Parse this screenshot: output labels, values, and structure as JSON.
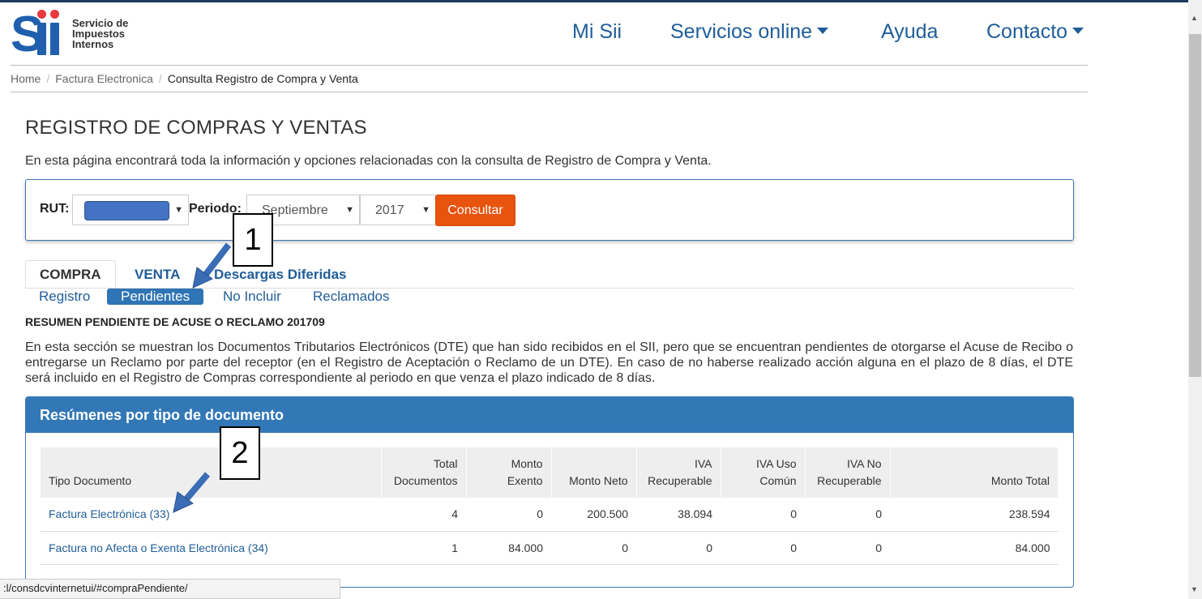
{
  "header": {
    "logo_lines": [
      "Servicio de",
      "Impuestos",
      "Internos"
    ],
    "nav": [
      {
        "label": "Mi Sii",
        "dropdown": false
      },
      {
        "label": "Servicios online",
        "dropdown": true
      },
      {
        "label": "Ayuda",
        "dropdown": false
      },
      {
        "label": "Contacto",
        "dropdown": true
      }
    ]
  },
  "breadcrumb": {
    "items": [
      "Home",
      "Factura Electronica"
    ],
    "current": "Consulta Registro de Compra y Venta"
  },
  "page": {
    "title": "REGISTRO DE COMPRAS Y VENTAS",
    "intro": "En esta página encontrará toda la información y opciones relacionadas con la consulta de Registro de Compra y Venta."
  },
  "filters": {
    "rut_label": "RUT:",
    "periodo_label": "Periodo:",
    "month": "Septiembre",
    "year": "2017",
    "submit_label": "Consultar"
  },
  "tabs": {
    "items": [
      "COMPRA",
      "VENTA",
      "Descargas Diferidas"
    ],
    "active": "COMPRA"
  },
  "subtabs": {
    "items": [
      "Registro",
      "Pendientes",
      "No Incluir",
      "Reclamados"
    ],
    "active": "Pendientes"
  },
  "section": {
    "heading": "RESUMEN PENDIENTE DE ACUSE O RECLAMO 201709",
    "description": "En esta sección se muestran los Documentos Tributarios Electrónicos (DTE) que han sido recibidos en el SII, pero que se encuentran pendientes de otorgarse el Acuse de Recibo o entregarse un Reclamo por parte del receptor (en el Registro de Aceptación o Reclamo de un DTE). En caso de no haberse realizado acción alguna en el plazo de 8 días, el DTE será incluido en el Registro de Compras correspondiente al periodo en que venza el plazo indicado de 8 días."
  },
  "summary_panel": {
    "title": "Resúmenes por tipo de documento",
    "columns": [
      [
        "Tipo Documento"
      ],
      [
        "Total",
        "Documentos"
      ],
      [
        "Monto",
        "Exento"
      ],
      [
        "Monto Neto"
      ],
      [
        "IVA",
        "Recuperable"
      ],
      [
        "IVA Uso",
        "Común"
      ],
      [
        "IVA No",
        "Recuperable"
      ],
      [
        "Monto Total"
      ]
    ],
    "rows": [
      [
        "Factura Electrónica (33)",
        "4",
        "0",
        "200.500",
        "38.094",
        "0",
        "0",
        "238.594"
      ],
      [
        "Factura no Afecta o Exenta Electrónica (34)",
        "1",
        "84.000",
        "0",
        "0",
        "0",
        "0",
        "84.000"
      ]
    ]
  },
  "callouts": [
    "1",
    "2"
  ],
  "status_url": ":l/consdcvinternetui/#compraPendiente/",
  "colors": {
    "brand_blue": "#1f5d99",
    "panel_blue": "#3278b6",
    "button_orange": "#e8530e",
    "logo_red": "#e8393c"
  }
}
